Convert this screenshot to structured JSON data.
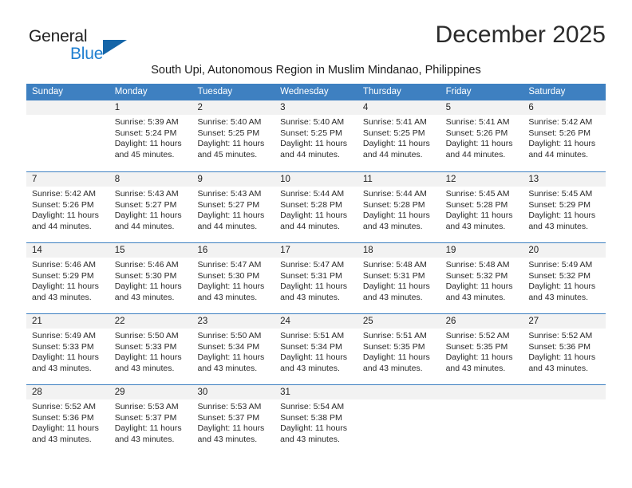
{
  "logo": {
    "word_one": "General",
    "word_two": "Blue",
    "triangle_color": "#1565a8",
    "blue_text_color": "#1f7fd0"
  },
  "header": {
    "month_title": "December 2025",
    "location_subtitle": "South Upi, Autonomous Region in Muslim Mindanao, Philippines"
  },
  "calendar": {
    "header_color": "#3e80c1",
    "day_band_color": "#f2f2f2",
    "weekdays": [
      "Sunday",
      "Monday",
      "Tuesday",
      "Wednesday",
      "Thursday",
      "Friday",
      "Saturday"
    ],
    "weeks": [
      [
        {
          "day": "",
          "sunrise": "",
          "sunset": "",
          "daylight_line1": "",
          "daylight_line2": "",
          "empty": true
        },
        {
          "day": "1",
          "sunrise": "Sunrise: 5:39 AM",
          "sunset": "Sunset: 5:24 PM",
          "daylight_line1": "Daylight: 11 hours",
          "daylight_line2": "and 45 minutes."
        },
        {
          "day": "2",
          "sunrise": "Sunrise: 5:40 AM",
          "sunset": "Sunset: 5:25 PM",
          "daylight_line1": "Daylight: 11 hours",
          "daylight_line2": "and 45 minutes."
        },
        {
          "day": "3",
          "sunrise": "Sunrise: 5:40 AM",
          "sunset": "Sunset: 5:25 PM",
          "daylight_line1": "Daylight: 11 hours",
          "daylight_line2": "and 44 minutes."
        },
        {
          "day": "4",
          "sunrise": "Sunrise: 5:41 AM",
          "sunset": "Sunset: 5:25 PM",
          "daylight_line1": "Daylight: 11 hours",
          "daylight_line2": "and 44 minutes."
        },
        {
          "day": "5",
          "sunrise": "Sunrise: 5:41 AM",
          "sunset": "Sunset: 5:26 PM",
          "daylight_line1": "Daylight: 11 hours",
          "daylight_line2": "and 44 minutes."
        },
        {
          "day": "6",
          "sunrise": "Sunrise: 5:42 AM",
          "sunset": "Sunset: 5:26 PM",
          "daylight_line1": "Daylight: 11 hours",
          "daylight_line2": "and 44 minutes."
        }
      ],
      [
        {
          "day": "7",
          "sunrise": "Sunrise: 5:42 AM",
          "sunset": "Sunset: 5:26 PM",
          "daylight_line1": "Daylight: 11 hours",
          "daylight_line2": "and 44 minutes."
        },
        {
          "day": "8",
          "sunrise": "Sunrise: 5:43 AM",
          "sunset": "Sunset: 5:27 PM",
          "daylight_line1": "Daylight: 11 hours",
          "daylight_line2": "and 44 minutes."
        },
        {
          "day": "9",
          "sunrise": "Sunrise: 5:43 AM",
          "sunset": "Sunset: 5:27 PM",
          "daylight_line1": "Daylight: 11 hours",
          "daylight_line2": "and 44 minutes."
        },
        {
          "day": "10",
          "sunrise": "Sunrise: 5:44 AM",
          "sunset": "Sunset: 5:28 PM",
          "daylight_line1": "Daylight: 11 hours",
          "daylight_line2": "and 44 minutes."
        },
        {
          "day": "11",
          "sunrise": "Sunrise: 5:44 AM",
          "sunset": "Sunset: 5:28 PM",
          "daylight_line1": "Daylight: 11 hours",
          "daylight_line2": "and 43 minutes."
        },
        {
          "day": "12",
          "sunrise": "Sunrise: 5:45 AM",
          "sunset": "Sunset: 5:28 PM",
          "daylight_line1": "Daylight: 11 hours",
          "daylight_line2": "and 43 minutes."
        },
        {
          "day": "13",
          "sunrise": "Sunrise: 5:45 AM",
          "sunset": "Sunset: 5:29 PM",
          "daylight_line1": "Daylight: 11 hours",
          "daylight_line2": "and 43 minutes."
        }
      ],
      [
        {
          "day": "14",
          "sunrise": "Sunrise: 5:46 AM",
          "sunset": "Sunset: 5:29 PM",
          "daylight_line1": "Daylight: 11 hours",
          "daylight_line2": "and 43 minutes."
        },
        {
          "day": "15",
          "sunrise": "Sunrise: 5:46 AM",
          "sunset": "Sunset: 5:30 PM",
          "daylight_line1": "Daylight: 11 hours",
          "daylight_line2": "and 43 minutes."
        },
        {
          "day": "16",
          "sunrise": "Sunrise: 5:47 AM",
          "sunset": "Sunset: 5:30 PM",
          "daylight_line1": "Daylight: 11 hours",
          "daylight_line2": "and 43 minutes."
        },
        {
          "day": "17",
          "sunrise": "Sunrise: 5:47 AM",
          "sunset": "Sunset: 5:31 PM",
          "daylight_line1": "Daylight: 11 hours",
          "daylight_line2": "and 43 minutes."
        },
        {
          "day": "18",
          "sunrise": "Sunrise: 5:48 AM",
          "sunset": "Sunset: 5:31 PM",
          "daylight_line1": "Daylight: 11 hours",
          "daylight_line2": "and 43 minutes."
        },
        {
          "day": "19",
          "sunrise": "Sunrise: 5:48 AM",
          "sunset": "Sunset: 5:32 PM",
          "daylight_line1": "Daylight: 11 hours",
          "daylight_line2": "and 43 minutes."
        },
        {
          "day": "20",
          "sunrise": "Sunrise: 5:49 AM",
          "sunset": "Sunset: 5:32 PM",
          "daylight_line1": "Daylight: 11 hours",
          "daylight_line2": "and 43 minutes."
        }
      ],
      [
        {
          "day": "21",
          "sunrise": "Sunrise: 5:49 AM",
          "sunset": "Sunset: 5:33 PM",
          "daylight_line1": "Daylight: 11 hours",
          "daylight_line2": "and 43 minutes."
        },
        {
          "day": "22",
          "sunrise": "Sunrise: 5:50 AM",
          "sunset": "Sunset: 5:33 PM",
          "daylight_line1": "Daylight: 11 hours",
          "daylight_line2": "and 43 minutes."
        },
        {
          "day": "23",
          "sunrise": "Sunrise: 5:50 AM",
          "sunset": "Sunset: 5:34 PM",
          "daylight_line1": "Daylight: 11 hours",
          "daylight_line2": "and 43 minutes."
        },
        {
          "day": "24",
          "sunrise": "Sunrise: 5:51 AM",
          "sunset": "Sunset: 5:34 PM",
          "daylight_line1": "Daylight: 11 hours",
          "daylight_line2": "and 43 minutes."
        },
        {
          "day": "25",
          "sunrise": "Sunrise: 5:51 AM",
          "sunset": "Sunset: 5:35 PM",
          "daylight_line1": "Daylight: 11 hours",
          "daylight_line2": "and 43 minutes."
        },
        {
          "day": "26",
          "sunrise": "Sunrise: 5:52 AM",
          "sunset": "Sunset: 5:35 PM",
          "daylight_line1": "Daylight: 11 hours",
          "daylight_line2": "and 43 minutes."
        },
        {
          "day": "27",
          "sunrise": "Sunrise: 5:52 AM",
          "sunset": "Sunset: 5:36 PM",
          "daylight_line1": "Daylight: 11 hours",
          "daylight_line2": "and 43 minutes."
        }
      ],
      [
        {
          "day": "28",
          "sunrise": "Sunrise: 5:52 AM",
          "sunset": "Sunset: 5:36 PM",
          "daylight_line1": "Daylight: 11 hours",
          "daylight_line2": "and 43 minutes."
        },
        {
          "day": "29",
          "sunrise": "Sunrise: 5:53 AM",
          "sunset": "Sunset: 5:37 PM",
          "daylight_line1": "Daylight: 11 hours",
          "daylight_line2": "and 43 minutes."
        },
        {
          "day": "30",
          "sunrise": "Sunrise: 5:53 AM",
          "sunset": "Sunset: 5:37 PM",
          "daylight_line1": "Daylight: 11 hours",
          "daylight_line2": "and 43 minutes."
        },
        {
          "day": "31",
          "sunrise": "Sunrise: 5:54 AM",
          "sunset": "Sunset: 5:38 PM",
          "daylight_line1": "Daylight: 11 hours",
          "daylight_line2": "and 43 minutes."
        },
        {
          "day": "",
          "sunrise": "",
          "sunset": "",
          "daylight_line1": "",
          "daylight_line2": "",
          "empty": true
        },
        {
          "day": "",
          "sunrise": "",
          "sunset": "",
          "daylight_line1": "",
          "daylight_line2": "",
          "empty": true
        },
        {
          "day": "",
          "sunrise": "",
          "sunset": "",
          "daylight_line1": "",
          "daylight_line2": "",
          "empty": true
        }
      ]
    ]
  }
}
